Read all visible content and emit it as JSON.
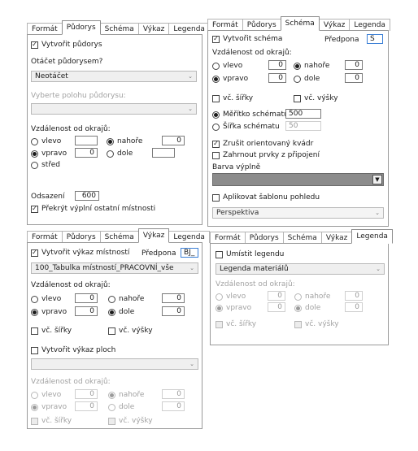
{
  "p1": {
    "tabs": [
      "Formát",
      "Půdorys",
      "Schéma",
      "Výkaz",
      "Legenda"
    ],
    "create_label": "Vytvořit půdorys",
    "rotate_label": "Otáčet půdorysem?",
    "rotate_value": "Neotáčet",
    "pos_label": "Vyberte polohu půdorysu:",
    "dist_label": "Vzdálenost od okrajů:",
    "left": "vlevo",
    "top": "nahoře",
    "right": "vpravo",
    "bottom": "dole",
    "center": "střed",
    "v_left": "",
    "v_top": "0",
    "v_right": "0",
    "v_bottom": "",
    "offset_label": "Odsazení",
    "offset_value": "600",
    "cover_label": "Překrýt výplní ostatní místnosti"
  },
  "p2": {
    "tabs": [
      "Formát",
      "Půdorys",
      "Schéma",
      "Výkaz",
      "Legenda"
    ],
    "create_label": "Vytvořit schéma",
    "prefix_label": "Předpona",
    "prefix_value": "S",
    "dist_label": "Vzdálenost od okrajů:",
    "left": "vlevo",
    "top": "nahoře",
    "right": "vpravo",
    "bottom": "dole",
    "v_left": "0",
    "v_top": "0",
    "v_right": "0",
    "v_bottom": "0",
    "incl_width": "vč. šířky",
    "incl_height": "vč. výšky",
    "scale_label": "Měřítko schématu",
    "scale_value": "500",
    "width_label": "Šířka schématu",
    "width_value": "50",
    "cancel_box": "Zrušit orientovaný kvádr",
    "include_elems": "Zahrnout prvky z připojení",
    "fill_label": "Barva výplně",
    "fill_color": "#8c8c8c",
    "apply_template": "Aplikovat šablonu pohledu",
    "template_value": "Perspektiva"
  },
  "p3": {
    "tabs": [
      "Formát",
      "Půdorys",
      "Schéma",
      "Výkaz",
      "Legenda"
    ],
    "create_label": "Vytvořit výkaz místností",
    "prefix_label": "Předpona",
    "prefix_value": "BJ_",
    "schedule_value": "100_Tabulka místností_PRACOVNÍ_vše",
    "dist_label": "Vzdálenost od okrajů:",
    "left": "vlevo",
    "top": "nahoře",
    "right": "vpravo",
    "bottom": "dole",
    "v_left": "0",
    "v_top": "0",
    "v_right": "0",
    "v_bottom": "0",
    "incl_width": "vč. šířky",
    "incl_height": "vč. výšky",
    "area_label": "Vytvořit výkaz ploch",
    "dist2_label": "Vzdálenost od okrajů:",
    "v2_left": "0",
    "v2_top": "0",
    "v2_right": "0",
    "v2_bottom": "0"
  },
  "p4": {
    "tabs": [
      "Formát",
      "Půdorys",
      "Schéma",
      "Výkaz",
      "Legenda"
    ],
    "place_label": "Umístit legendu",
    "legend_value": "Legenda materiálů",
    "dist_label": "Vzdálenost od okrajů:",
    "left": "vlevo",
    "top": "nahoře",
    "right": "vpravo",
    "bottom": "dole",
    "v_left": "0",
    "v_top": "0",
    "v_right": "0",
    "v_bottom": "0",
    "incl_width": "vč. šířky",
    "incl_height": "vč. výšky"
  }
}
